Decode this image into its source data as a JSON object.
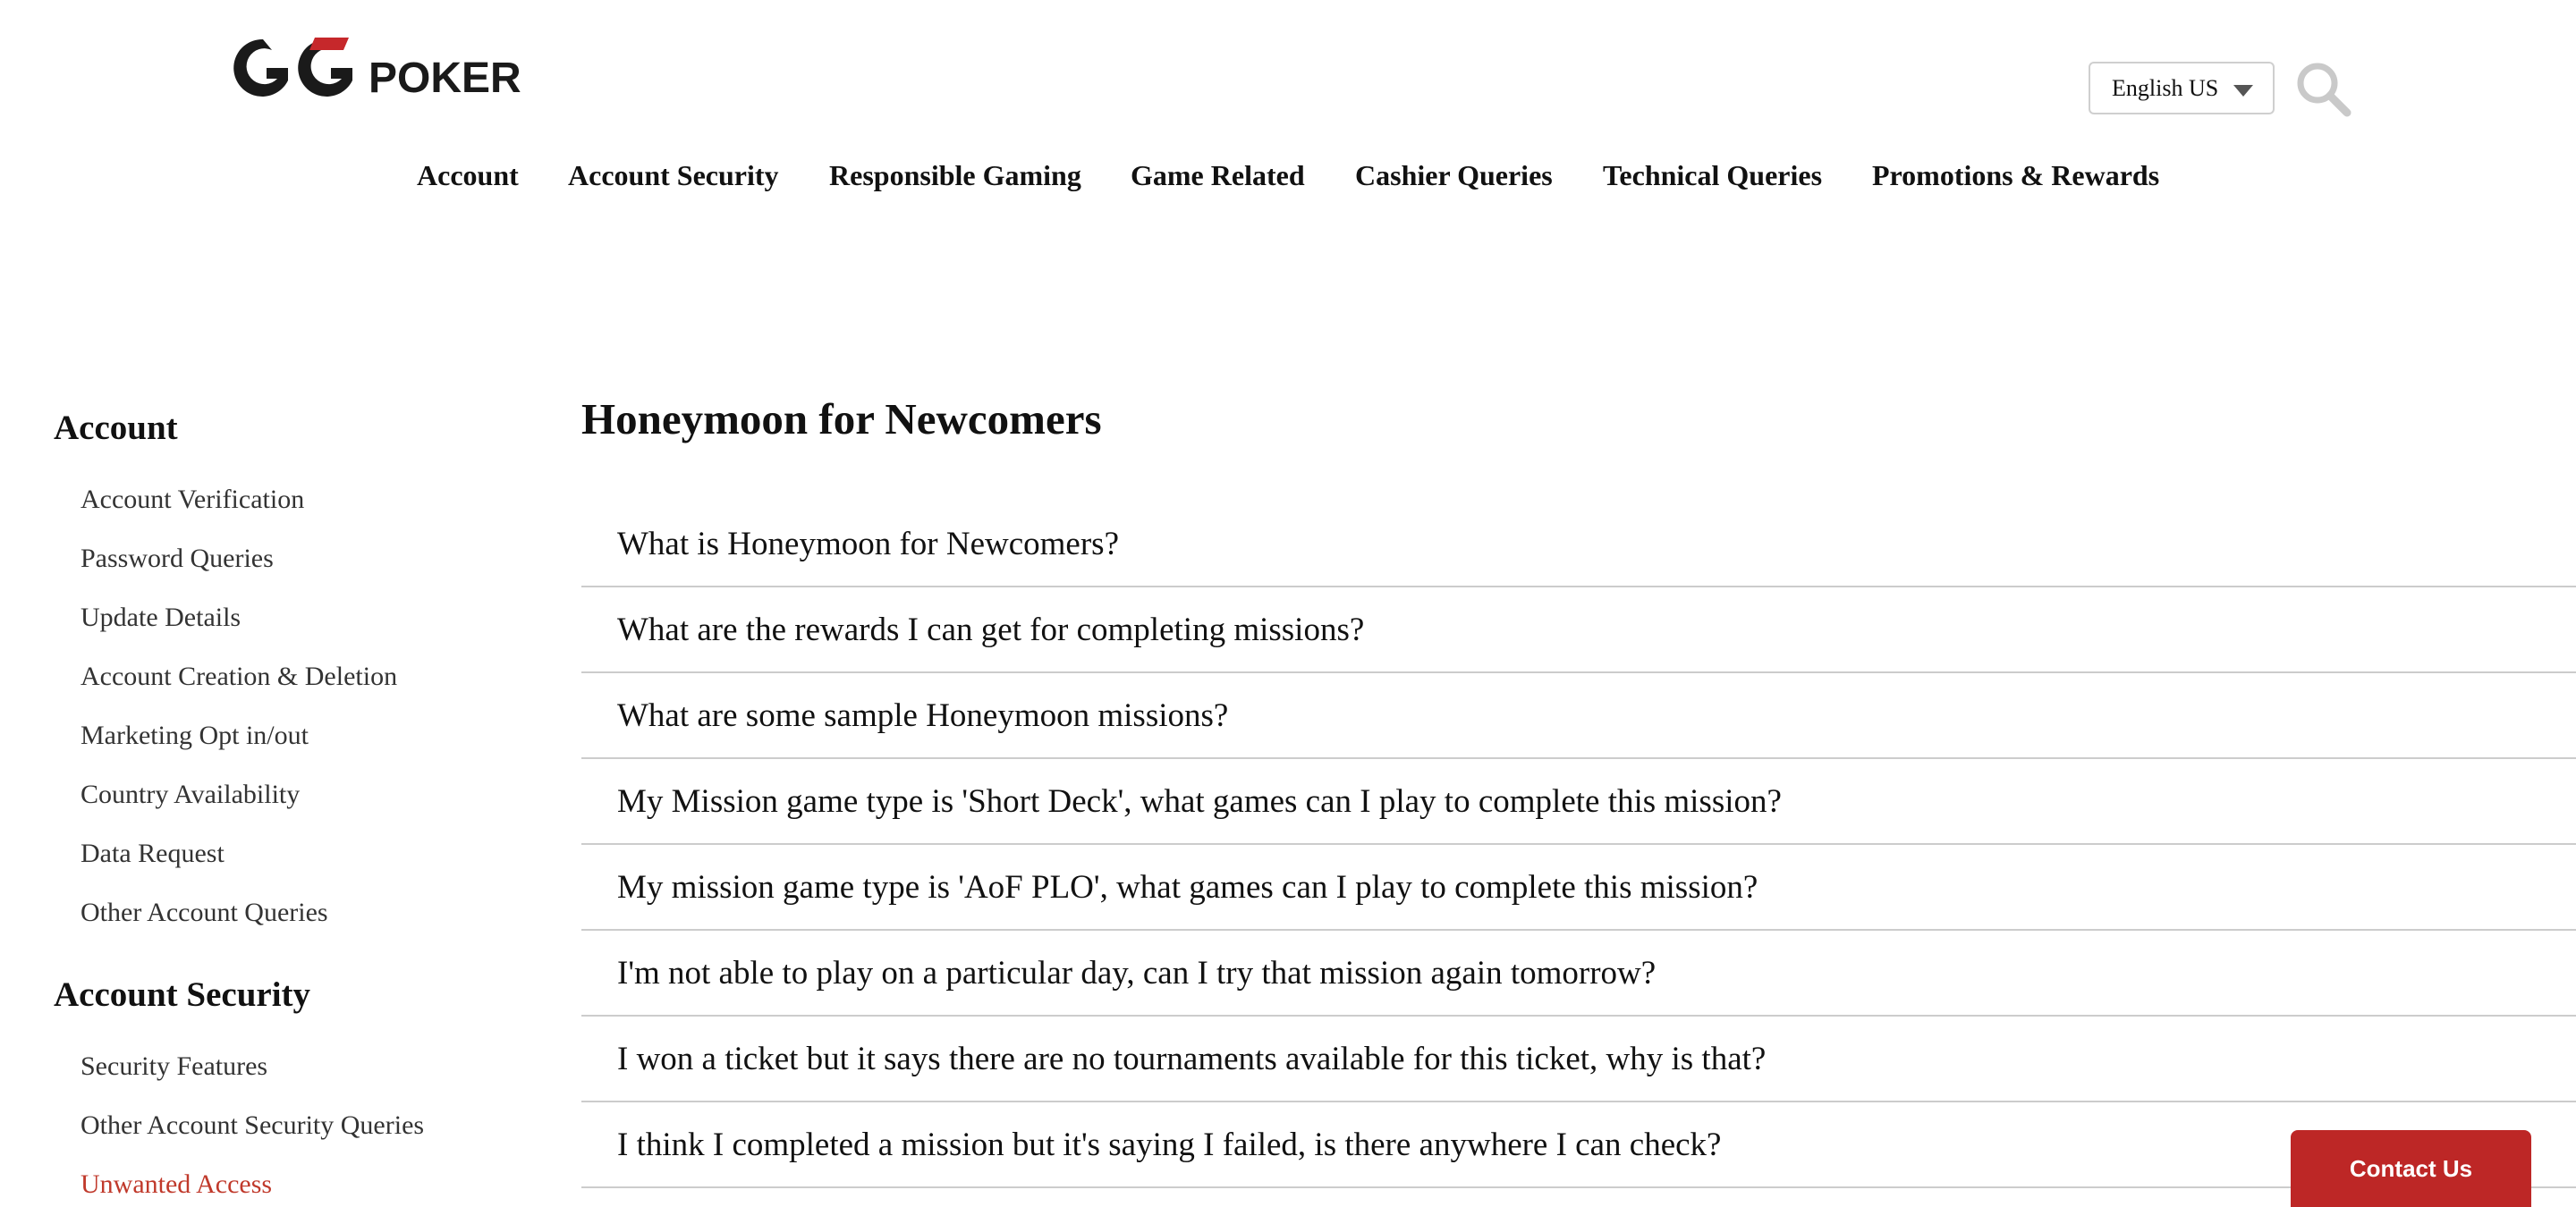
{
  "brand": {
    "logo_mark": "GG",
    "logo_word": "POKER",
    "accent_color": "#c6282b"
  },
  "header": {
    "language": "English US",
    "search_icon": "search-icon"
  },
  "topnav": [
    {
      "label": "Account"
    },
    {
      "label": "Account Security"
    },
    {
      "label": "Responsible Gaming"
    },
    {
      "label": "Game Related"
    },
    {
      "label": "Cashier Queries"
    },
    {
      "label": "Technical Queries"
    },
    {
      "label": "Promotions & Rewards"
    }
  ],
  "sidebar": {
    "sections": [
      {
        "heading": "Account",
        "items": [
          {
            "label": "Account Verification"
          },
          {
            "label": "Password Queries"
          },
          {
            "label": "Update Details"
          },
          {
            "label": "Account Creation & Deletion"
          },
          {
            "label": "Marketing Opt in/out"
          },
          {
            "label": "Country Availability"
          },
          {
            "label": "Data Request"
          },
          {
            "label": "Other Account Queries"
          }
        ]
      },
      {
        "heading": "Account Security",
        "items": [
          {
            "label": "Security Features"
          },
          {
            "label": "Other Account Security Queries"
          },
          {
            "label": "Unwanted Access",
            "active": true
          }
        ]
      }
    ],
    "active_color": "#c0392b"
  },
  "main": {
    "title": "Honeymoon for Newcomers",
    "faqs": [
      "What is Honeymoon for Newcomers?",
      "What are the rewards I can get for completing missions?",
      "What are some sample Honeymoon missions?",
      "My Mission game type is 'Short Deck', what games can I play to complete this mission?",
      "My mission game type is 'AoF PLO', what games can I play to complete this mission?",
      "I'm not able to play on a particular day, can I try that mission again tomorrow?",
      "I won a ticket but it says there are no tournaments available for this ticket, why is that?",
      "I think I completed a mission but it's saying I failed, is there anywhere I can check?"
    ]
  },
  "contact": {
    "label": "Contact Us",
    "color": "#bd2726"
  }
}
